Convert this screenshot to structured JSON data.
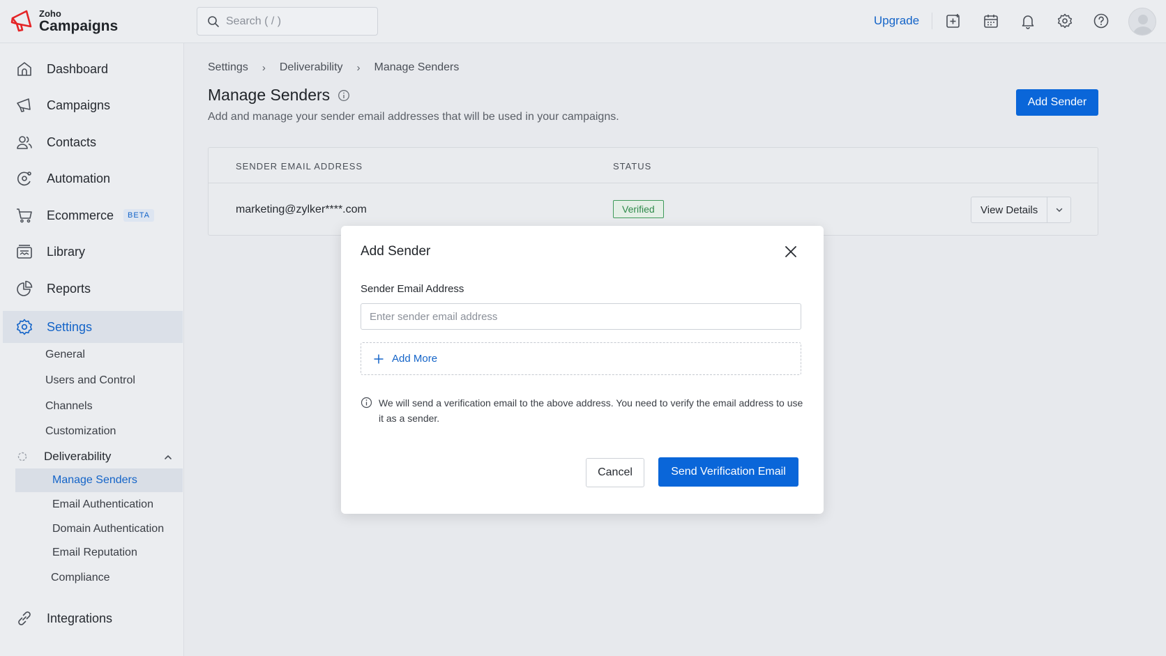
{
  "app": {
    "logo_small": "Zoho",
    "logo_big": "Campaigns",
    "brand_color": "#e42527",
    "accent_color": "#0a66d9"
  },
  "topbar": {
    "search_placeholder": "Search ( / )",
    "upgrade_label": "Upgrade",
    "icons": [
      "add-square-icon",
      "calendar-icon",
      "bell-icon",
      "gear-icon",
      "help-icon",
      "avatar"
    ]
  },
  "sidebar": {
    "items": [
      {
        "label": "Dashboard",
        "icon": "home-icon"
      },
      {
        "label": "Campaigns",
        "icon": "megaphone-icon"
      },
      {
        "label": "Contacts",
        "icon": "users-icon"
      },
      {
        "label": "Automation",
        "icon": "automation-icon"
      },
      {
        "label": "Ecommerce",
        "icon": "cart-icon",
        "badge": "BETA"
      },
      {
        "label": "Library",
        "icon": "library-icon"
      },
      {
        "label": "Reports",
        "icon": "pie-chart-icon"
      },
      {
        "label": "Settings",
        "icon": "gear-icon",
        "active": true
      },
      {
        "label": "Integrations",
        "icon": "link-icon"
      }
    ],
    "settings_sub": [
      "General",
      "Users and Control",
      "Channels",
      "Customization"
    ],
    "deliverability": {
      "label": "Deliverability",
      "items": [
        "Manage Senders",
        "Email Authentication",
        "Domain Authentication",
        "Email Reputation"
      ]
    },
    "compliance": "Compliance"
  },
  "breadcrumb": [
    "Settings",
    "Deliverability",
    "Manage Senders"
  ],
  "page": {
    "title": "Manage Senders",
    "subtitle": "Add and manage your sender email addresses that will be used in your campaigns.",
    "add_sender_label": "Add Sender"
  },
  "table": {
    "columns": [
      "SENDER EMAIL ADDRESS",
      "STATUS"
    ],
    "rows": [
      {
        "email": "marketing@zylker****.com",
        "status": "Verified",
        "action": "View Details"
      }
    ]
  },
  "modal": {
    "title": "Add Sender",
    "field_label": "Sender Email Address",
    "placeholder": "Enter sender email address",
    "add_more_label": "Add More",
    "note": "We will send a verification email to the above address. You need to verify the email address to use it as a sender.",
    "cancel_label": "Cancel",
    "submit_label": "Send Verification Email"
  }
}
